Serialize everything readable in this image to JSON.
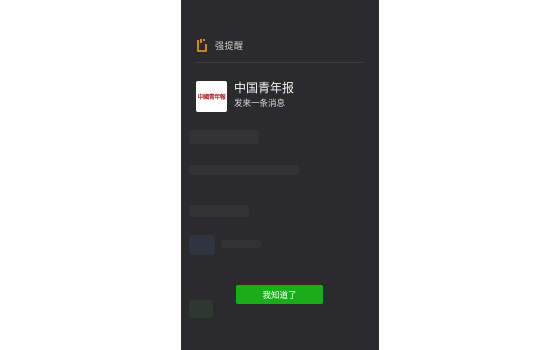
{
  "header": {
    "icon": "alarm-bell-icon",
    "label": "强提醒"
  },
  "notification": {
    "avatar_text": "中國青年報",
    "title": "中国青年报",
    "subtitle": "发来一条消息"
  },
  "actions": {
    "ok_label": "我知道了"
  },
  "colors": {
    "background": "#2b2b2d",
    "accent": "#1aad19",
    "icon": "#f0a020"
  }
}
